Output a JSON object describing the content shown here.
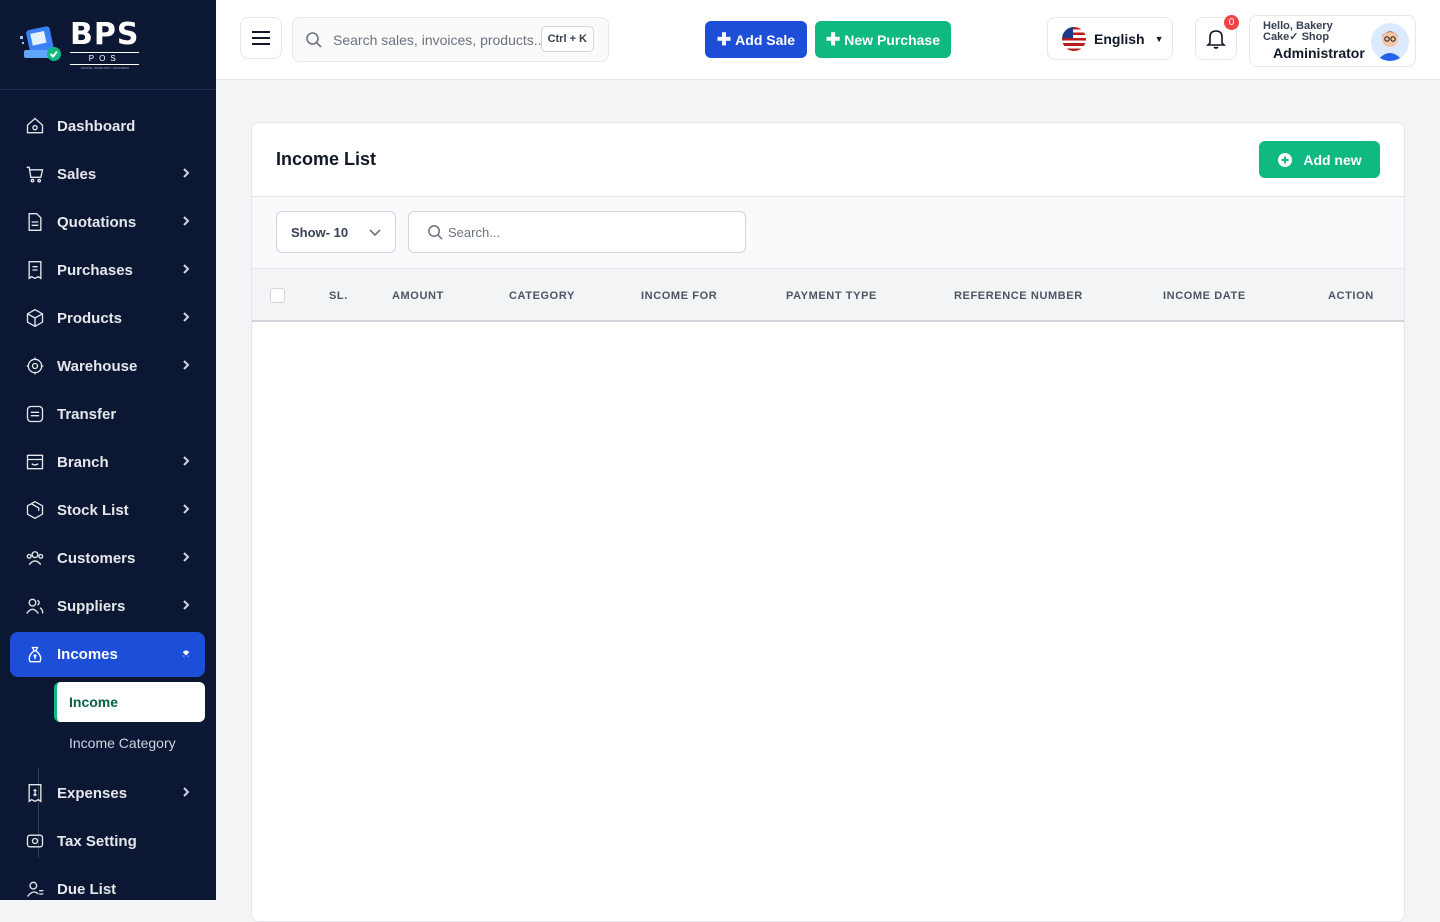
{
  "brand": {
    "name": "BPS",
    "sub": "POS",
    "tagline": "ONLINE | INVENTORY | BUSINESS"
  },
  "sidebar": {
    "items": [
      {
        "label": "Dashboard",
        "icon": "home-icon",
        "chevron": false
      },
      {
        "label": "Sales",
        "icon": "cart-icon",
        "chevron": true
      },
      {
        "label": "Quotations",
        "icon": "document-icon",
        "chevron": true
      },
      {
        "label": "Purchases",
        "icon": "receipt-icon",
        "chevron": true
      },
      {
        "label": "Products",
        "icon": "box-icon",
        "chevron": true
      },
      {
        "label": "Warehouse",
        "icon": "warehouse-icon",
        "chevron": true
      },
      {
        "label": "Transfer",
        "icon": "transfer-icon",
        "chevron": false
      },
      {
        "label": "Branch",
        "icon": "store-icon",
        "chevron": true
      },
      {
        "label": "Stock List",
        "icon": "package-icon",
        "chevron": true
      },
      {
        "label": "Customers",
        "icon": "users-icon",
        "chevron": true
      },
      {
        "label": "Suppliers",
        "icon": "supplier-icon",
        "chevron": true
      },
      {
        "label": "Incomes",
        "icon": "money-bag-icon",
        "chevron": true,
        "active": true
      },
      {
        "label": "Expenses",
        "icon": "expense-icon",
        "chevron": true
      },
      {
        "label": "Tax Setting",
        "icon": "tax-icon",
        "chevron": false
      },
      {
        "label": "Due List",
        "icon": "due-user-icon",
        "chevron": false
      }
    ],
    "sub_items": [
      {
        "label": "Income",
        "active": true
      },
      {
        "label": "Income Category",
        "active": false
      }
    ]
  },
  "topbar": {
    "search_placeholder": "Search sales, invoices, products...",
    "shortcut": "Ctrl + K",
    "add_sale": "Add Sale",
    "new_purchase": "New Purchase",
    "language": "English",
    "notifications": "0",
    "greeting": "Hello, Bakery Cake✓ Shop",
    "role": "Administrator"
  },
  "page": {
    "title": "Income List",
    "add_new": "Add new",
    "show": "Show- 10",
    "search_placeholder": "Search...",
    "columns": [
      "SL.",
      "AMOUNT",
      "CATEGORY",
      "INCOME FOR",
      "PAYMENT TYPE",
      "REFERENCE NUMBER",
      "INCOME DATE",
      "ACTION"
    ],
    "rows": []
  },
  "colors": {
    "sidebar": "#0b1733",
    "primary": "#1d4ed8",
    "success": "#10b981",
    "danger": "#ef4444"
  }
}
